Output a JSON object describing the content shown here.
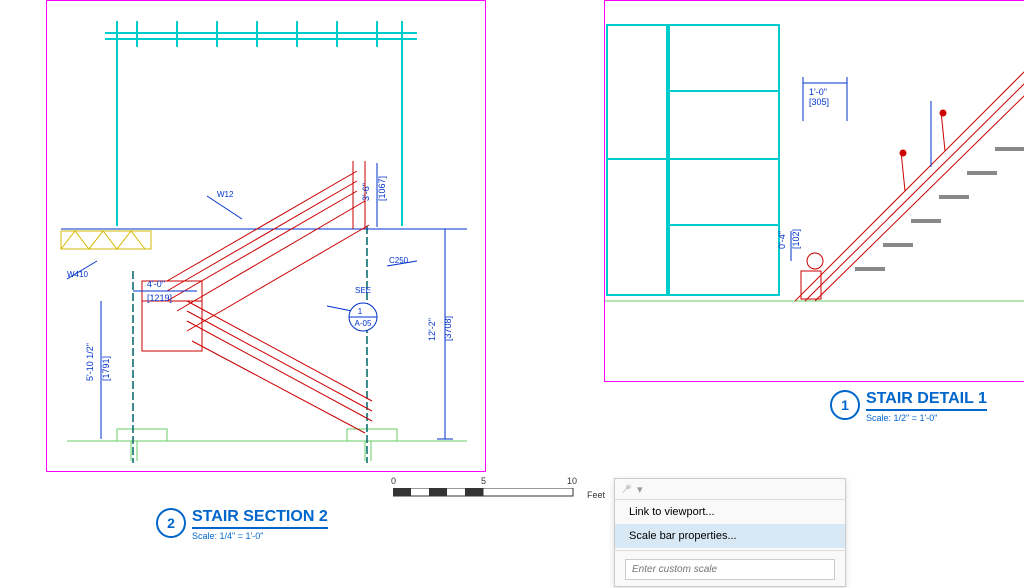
{
  "viewport1": {
    "title_num": "2",
    "title": "STAIR SECTION 2",
    "scale": "Scale: 1/4\" = 1'-0\"",
    "dims": {
      "h_overall": "12'-2\"",
      "h_overall_mm": "[3708]",
      "h_lower": "5'-10 1/2\"",
      "h_lower_mm": "[1791]",
      "w_landing": "4'-0\"",
      "w_landing_mm": "[1219]",
      "h_upper": "3'-6\"",
      "h_upper_mm": "[1067]"
    },
    "labels": {
      "w12": "W12",
      "w410": "W410",
      "c250": "C250",
      "see": "SEE",
      "detail_ref_top": "1",
      "detail_ref_bot": "A-05"
    }
  },
  "viewport2": {
    "title_num": "1",
    "title": "STAIR DETAIL 1",
    "scale": "Scale: 1/2\" = 1'-0\"",
    "dims": {
      "d1": "1'-0\"",
      "d1_mm": "[305]",
      "d2": "0'-4\"",
      "d2_mm": "[102]"
    }
  },
  "scalebar": {
    "tick0": "0",
    "tick5": "5",
    "tick10": "10",
    "unit": "Feet"
  },
  "menu": {
    "item1": "Link to viewport...",
    "item2": "Scale bar properties...",
    "placeholder": "Enter custom scale"
  }
}
